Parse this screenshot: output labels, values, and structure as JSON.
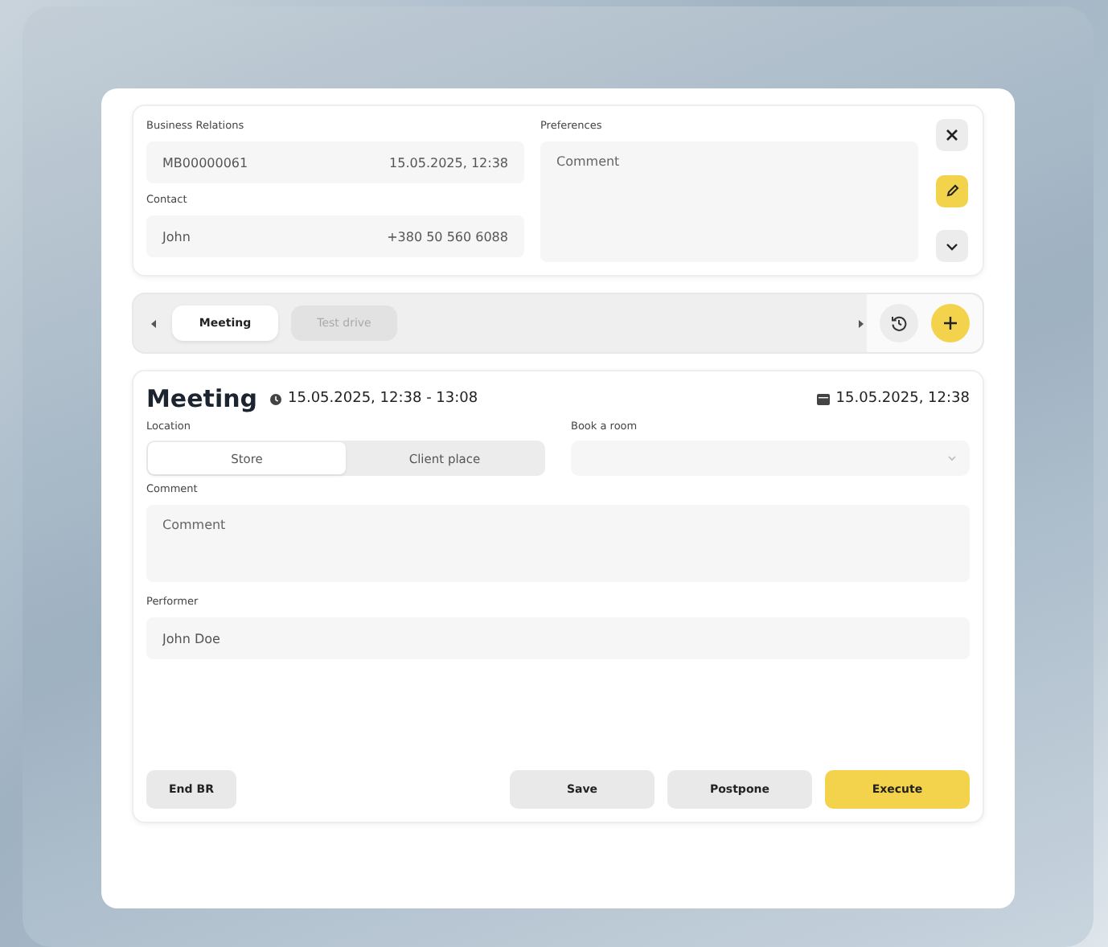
{
  "relation": {
    "label": "Business Relations",
    "number": "MB00000061",
    "date": "15.05.2025, 12:38"
  },
  "contact": {
    "label": "Contact",
    "name": "John",
    "phone": "+380 50 560 6088"
  },
  "preferences": {
    "label": "Preferences",
    "placeholder": "Comment"
  },
  "tabs": [
    {
      "label": "Meeting",
      "selected": true
    },
    {
      "label": "Test drive",
      "selected": false
    }
  ],
  "activity": {
    "title": "Meeting",
    "time": "15.05.2025, 12:38 - 13:08",
    "date": "15.05.2025, 12:38",
    "location": {
      "label": "Location",
      "options": [
        {
          "label": "Store",
          "selected": true
        },
        {
          "label": "Client place",
          "selected": false
        }
      ]
    },
    "room": {
      "label": "Book a room"
    },
    "comment": {
      "label": "Comment",
      "placeholder": "Comment"
    },
    "performer": {
      "label": "Performer",
      "value": "John Doe"
    }
  },
  "buttons": [
    {
      "label": "End BR",
      "kind": "plain"
    },
    {
      "label": "Save",
      "kind": "plain"
    },
    {
      "label": "Postpone",
      "kind": "plain"
    },
    {
      "label": "Execute",
      "kind": "primary"
    }
  ]
}
